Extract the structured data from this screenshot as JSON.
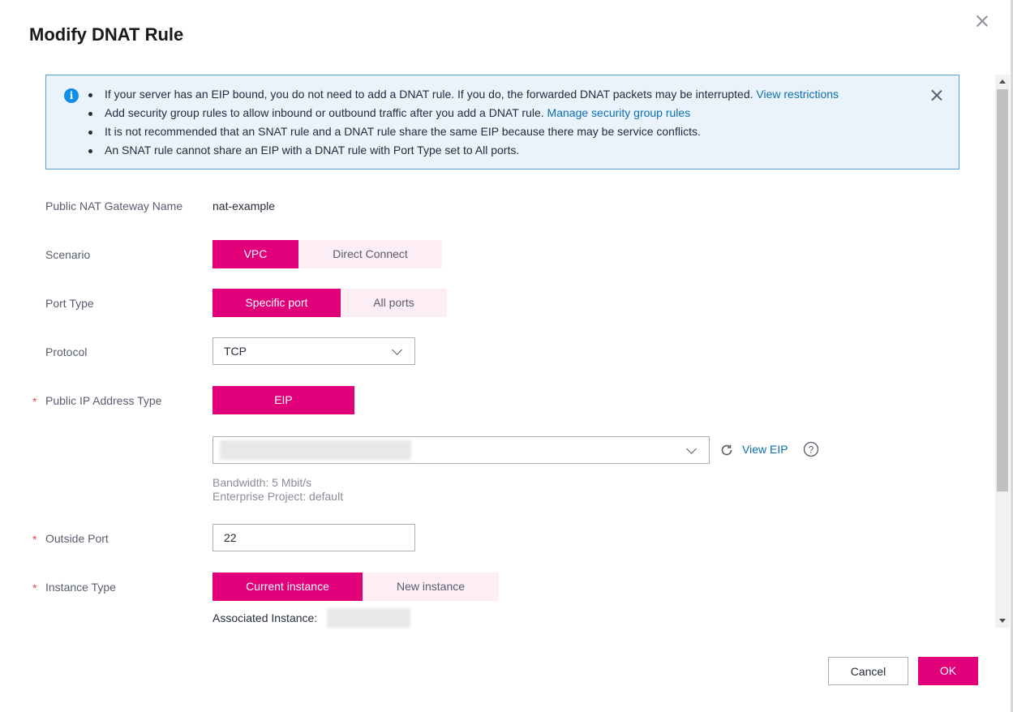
{
  "dialog": {
    "title": "Modify DNAT Rule"
  },
  "notice": {
    "items": [
      {
        "text": "If your server has an EIP bound, you do not need to add a DNAT rule. If you do, the forwarded DNAT packets may be interrupted. ",
        "link": "View restrictions"
      },
      {
        "text": "Add security group rules to allow inbound or outbound traffic after you add a DNAT rule. ",
        "link": "Manage security group rules"
      },
      {
        "text": "It is not recommended that an SNAT rule and a DNAT rule share the same EIP because there may be service conflicts.",
        "link": ""
      },
      {
        "text": "An SNAT rule cannot share an EIP with a DNAT rule with Port Type set to All ports.",
        "link": ""
      }
    ]
  },
  "form": {
    "gateway": {
      "label": "Public NAT Gateway Name",
      "value": "nat-example"
    },
    "scenario": {
      "label": "Scenario",
      "options": [
        "VPC",
        "Direct Connect"
      ],
      "selected": "VPC"
    },
    "port_type": {
      "label": "Port Type",
      "options": [
        "Specific port",
        "All ports"
      ],
      "selected": "Specific port"
    },
    "protocol": {
      "label": "Protocol",
      "value": "TCP"
    },
    "public_ip_type": {
      "label": "Public IP Address Type",
      "required_mark": "*",
      "option": "EIP"
    },
    "eip": {
      "view_link": "View EIP",
      "bandwidth": "Bandwidth: 5 Mbit/s",
      "enterprise_project": "Enterprise Project: default"
    },
    "outside_port": {
      "label": "Outside Port",
      "required_mark": "*",
      "value": "22"
    },
    "instance_type": {
      "label": "Instance Type",
      "required_mark": "*",
      "options": [
        "Current instance",
        "New instance"
      ],
      "selected": "Current instance",
      "associated_label": "Associated Instance:"
    }
  },
  "footer": {
    "cancel": "Cancel",
    "ok": "OK"
  },
  "colors": {
    "accent": "#e2007a",
    "accent_light": "#fdeef6",
    "link": "#0c6fb0",
    "info_bg": "#eaf3fb"
  }
}
